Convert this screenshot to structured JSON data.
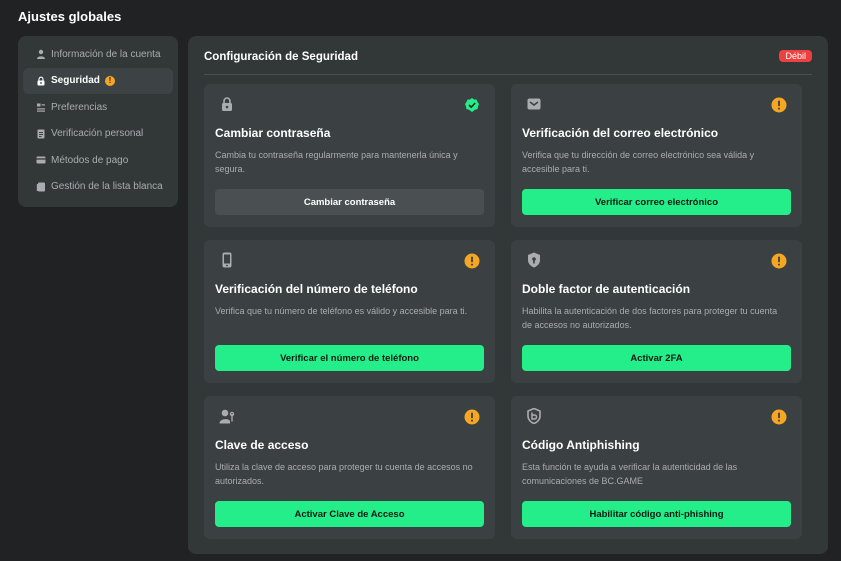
{
  "page": {
    "title": "Ajustes globales"
  },
  "sidebar": {
    "items": [
      {
        "label": "Información de la cuenta",
        "icon": "user-icon"
      },
      {
        "label": "Seguridad",
        "icon": "lock-icon",
        "badge": "!"
      },
      {
        "label": "Preferencias",
        "icon": "preferences-icon"
      },
      {
        "label": "Verificación personal",
        "icon": "id-document-icon"
      },
      {
        "label": "Métodos de pago",
        "icon": "credit-card-icon"
      },
      {
        "label": "Gestión de la lista blanca",
        "icon": "whitelist-icon"
      }
    ]
  },
  "security": {
    "title": "Configuración de Seguridad",
    "strength": "Débil",
    "cards": [
      {
        "title": "Cambiar contraseña",
        "description": "Cambia tu contraseña regularmente para mantenerla única y segura.",
        "button": "Cambiar contraseña",
        "status": "done",
        "icon": "lock-icon"
      },
      {
        "title": "Verificación del correo electrónico",
        "description": "Verifica que tu dirección de correo electrónico sea válida y accesible para ti.",
        "button": "Verificar correo electrónico",
        "status": "warning",
        "icon": "email-icon"
      },
      {
        "title": "Verificación del número de teléfono",
        "description": "Verifica que tu número de teléfono es válido y accesible para ti.",
        "button": "Verificar el número de teléfono",
        "status": "warning",
        "icon": "phone-icon"
      },
      {
        "title": "Doble factor de autenticación",
        "description": "Habilita la autenticación de dos factores para proteger tu cuenta de accesos no autorizados.",
        "button": "Activar 2FA",
        "status": "warning",
        "icon": "shield-icon"
      },
      {
        "title": "Clave de acceso",
        "description": "Utiliza la clave de acceso para proteger tu cuenta de accesos no autorizados.",
        "button": "Activar Clave de Acceso",
        "status": "warning",
        "icon": "passkey-icon"
      },
      {
        "title": "Código Antiphishing",
        "description": "Esta función te ayuda a verificar la autenticidad de las comunicaciones de BC.GAME",
        "button": "Habilitar código anti-phishing",
        "status": "warning",
        "icon": "anti-phishing-icon"
      }
    ]
  },
  "colors": {
    "background": "#202223",
    "panel": "#323738",
    "card": "#3b4042",
    "accent_green": "#24ee89",
    "warning": "#f5a623",
    "danger": "#ed4040"
  }
}
